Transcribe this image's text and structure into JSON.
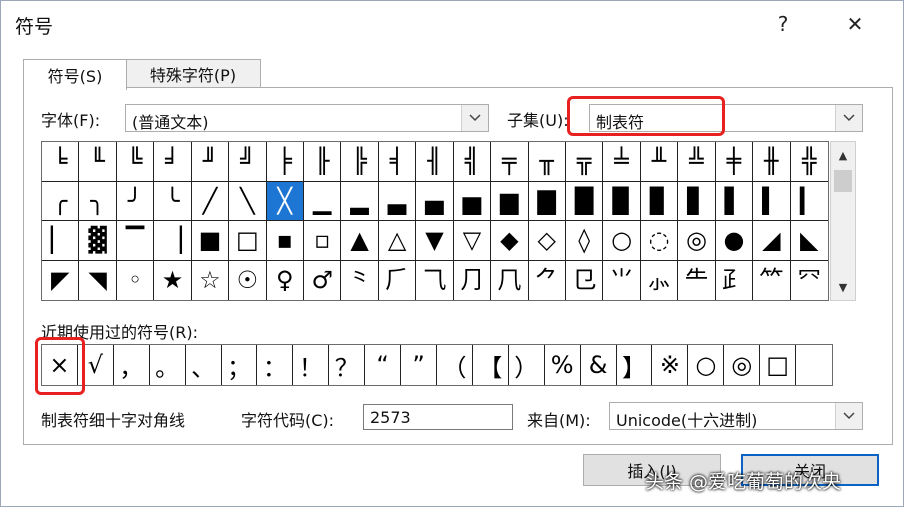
{
  "window": {
    "title": "符号",
    "help": "?",
    "close": "✕"
  },
  "tabs": [
    {
      "label": "符号(S)"
    },
    {
      "label": "特殊字符(P)"
    }
  ],
  "font": {
    "label": "字体(F):",
    "value": "(普通文本)"
  },
  "subset": {
    "label": "子集(U):",
    "value": "制表符"
  },
  "symbols": [
    "╘",
    "╙",
    "╚",
    "╛",
    "╜",
    "╝",
    "╞",
    "╟",
    "╠",
    "╡",
    "╢",
    "╣",
    "╤",
    "╥",
    "╦",
    "╧",
    "╨",
    "╩",
    "╪",
    "╫",
    "╬",
    "╭",
    "╮",
    "╯",
    "╰",
    "╱",
    "╲",
    "╳",
    "▁",
    "▂",
    "▃",
    "▄",
    "▅",
    "▆",
    "▇",
    "█",
    "▉",
    "▊",
    "▋",
    "▌",
    "▍",
    "▎",
    "▏",
    "▓",
    "▔",
    "▕",
    "■",
    "□",
    "▪",
    "▫",
    "▲",
    "△",
    "▼",
    "▽",
    "◆",
    "◇",
    "◊",
    "○",
    "◌",
    "◎",
    "●",
    "◢",
    "◣",
    "◤",
    "◥",
    "◦",
    "★",
    "☆",
    "☉",
    "♀",
    "♂",
    "⺀",
    "⺁",
    "⺄",
    "⺆",
    "⺇",
    "⺈",
    "⺋",
    "⺌",
    "⺗",
    "⺧",
    "⺪",
    "⺮",
    "⺳"
  ],
  "selected_index": 27,
  "recent": {
    "label": "近期使用过的符号(R):",
    "items": [
      "×",
      "√",
      "，",
      "。",
      "、",
      "；",
      "：",
      "！",
      "？",
      "“",
      "”",
      "（",
      "【",
      "）",
      "%",
      "&",
      "】",
      "※",
      "○",
      "◎",
      "□",
      ""
    ]
  },
  "char_name": "制表符细十字对角线",
  "char_code": {
    "label": "字符代码(C):",
    "value": "2573"
  },
  "from": {
    "label": "来自(M):",
    "value": "Unicode(十六进制)"
  },
  "buttons": {
    "insert": "插入(I)",
    "close": "关闭"
  },
  "watermark": "头条 @爱吃葡萄的次央"
}
